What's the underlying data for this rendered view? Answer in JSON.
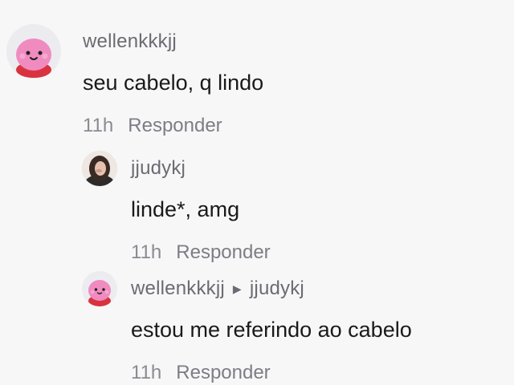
{
  "comments": [
    {
      "username": "wellenkkkjj",
      "text": "seu cabelo, q lindo",
      "time": "11h",
      "reply_label": "Responder",
      "avatar_icon": "pink-blob-avatar"
    },
    {
      "username": "jjudykj",
      "text": "linde*, amg",
      "time": "11h",
      "reply_label": "Responder",
      "avatar_icon": "photo-avatar"
    },
    {
      "username": "wellenkkkjj",
      "reply_to": "jjudykj",
      "text": "estou me referindo ao cabelo",
      "time": "11h",
      "reply_label": "Responder",
      "avatar_icon": "pink-blob-avatar"
    }
  ],
  "colors": {
    "background": "#f7f7f7",
    "username": "#6b6b73",
    "text": "#1a1a1a",
    "meta": "#8a8a92",
    "avatar_pink": "#f08bc0",
    "avatar_red": "#d8333f"
  }
}
